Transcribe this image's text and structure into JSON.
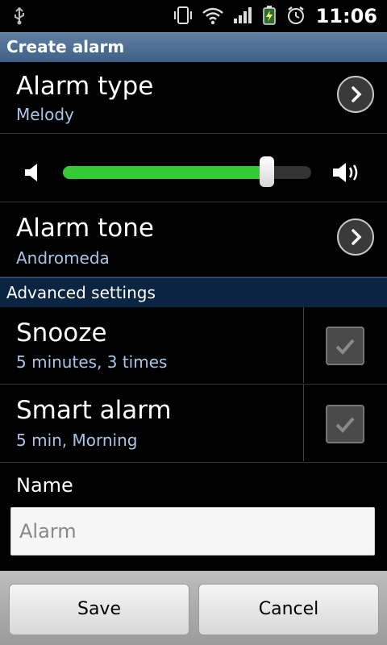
{
  "status_bar": {
    "time": "11:06",
    "icons": [
      "usb-icon",
      "vibrate-icon",
      "wifi-icon",
      "signal-icon",
      "battery-icon",
      "alarm-clock-icon"
    ]
  },
  "header": {
    "title": "Create alarm"
  },
  "alarm_type": {
    "label": "Alarm type",
    "value": "Melody"
  },
  "volume": {
    "level": 0.82,
    "accent": "#35c935"
  },
  "alarm_tone": {
    "label": "Alarm tone",
    "value": "Andromeda"
  },
  "advanced": {
    "label": "Advanced settings"
  },
  "snooze": {
    "label": "Snooze",
    "value": "5 minutes, 3 times",
    "checked": true
  },
  "smart_alarm": {
    "label": "Smart alarm",
    "value": "5 min, Morning",
    "checked": true
  },
  "name": {
    "label": "Name",
    "placeholder": "Alarm"
  },
  "buttons": {
    "save": "Save",
    "cancel": "Cancel"
  },
  "colors": {
    "header": "#4f6f96",
    "section": "#0b2441",
    "subtext": "#a9c5e8"
  }
}
